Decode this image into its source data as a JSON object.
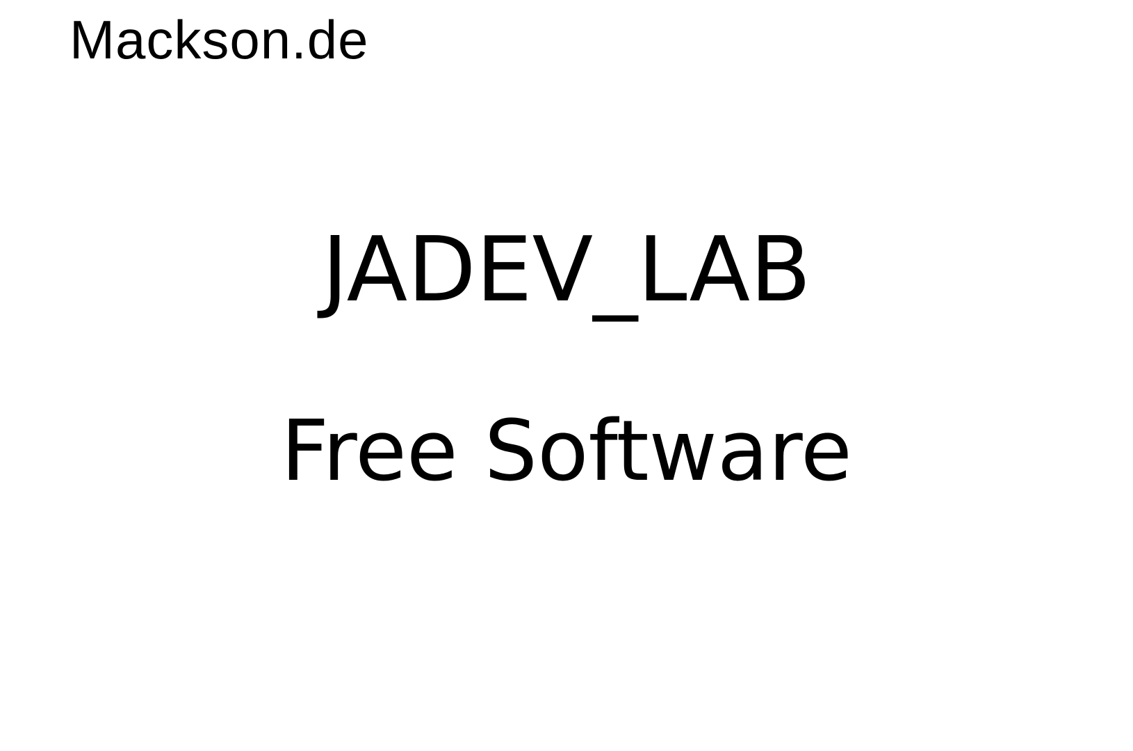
{
  "header": {
    "logo_text": "Mackson.de"
  },
  "main": {
    "title": "JADEV_LAB",
    "subtitle": "Free Software"
  }
}
